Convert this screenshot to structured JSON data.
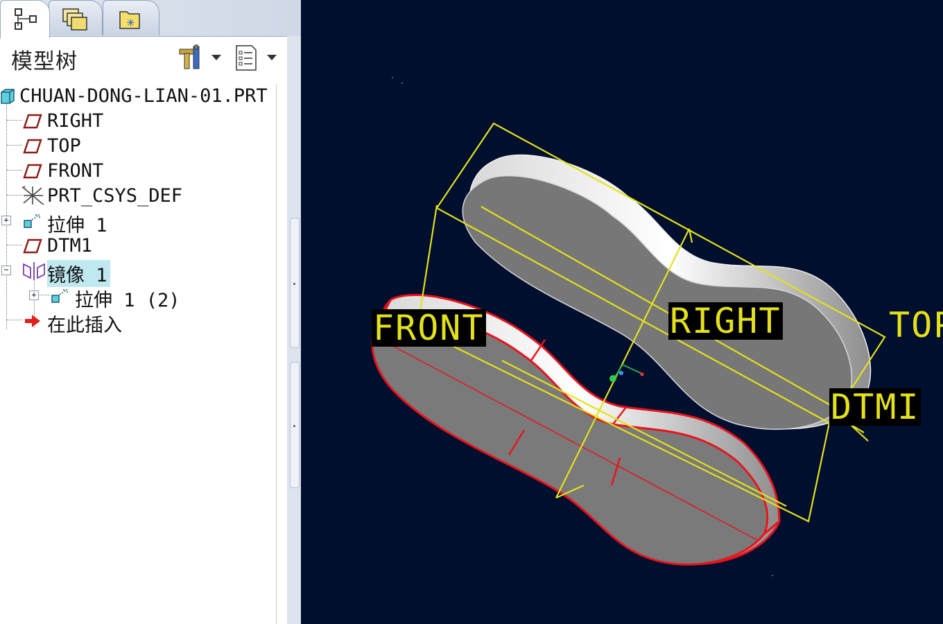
{
  "tabs": [
    {
      "name": "model-tree-tab",
      "icon": "tree-icon"
    },
    {
      "name": "folder-browser-tab",
      "icon": "folders-icon"
    },
    {
      "name": "favorites-tab",
      "icon": "favorites-icon"
    }
  ],
  "model_tree": {
    "title": "模型树",
    "settings_icon": "tools-icon",
    "show_icon": "list-icon",
    "items": [
      {
        "label": "CHUAN-DONG-LIAN-01.PRT",
        "icon": "part-icon"
      },
      {
        "label": "RIGHT",
        "icon": "datum-plane-icon"
      },
      {
        "label": "TOP",
        "icon": "datum-plane-icon"
      },
      {
        "label": "FRONT",
        "icon": "datum-plane-icon"
      },
      {
        "label": "PRT_CSYS_DEF",
        "icon": "csys-icon"
      },
      {
        "label": "拉伸 1",
        "icon": "extrude-icon",
        "expander": "+"
      },
      {
        "label": "DTM1",
        "icon": "datum-plane-icon"
      },
      {
        "label": "镜像 1",
        "icon": "mirror-icon",
        "expander": "−",
        "selected": true
      },
      {
        "label": "拉伸 1 (2)",
        "icon": "extrude-icon",
        "expander": "+"
      },
      {
        "label": "在此插入",
        "icon": "insert-here-arrow-icon"
      }
    ]
  },
  "viewport": {
    "background": "#010f2f",
    "datum_color": "#e3e21a",
    "highlight_color": "#e8141c",
    "datum_labels": {
      "front": "FRONT",
      "right": "RIGHT",
      "top": "TOP",
      "dtm1": "DTMI"
    }
  }
}
